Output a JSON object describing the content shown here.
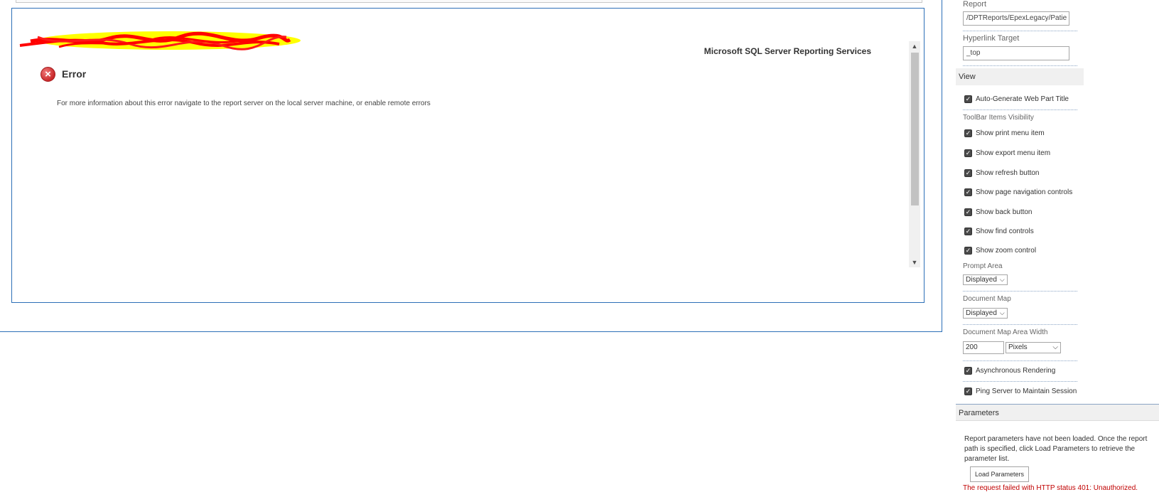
{
  "report_viewer": {
    "product_title": "Microsoft SQL Server Reporting Services",
    "error_title": "Error",
    "error_message": "For more information about this error navigate to the report server on the local server machine, or enable remote errors"
  },
  "tool_pane": {
    "report_label": "Report",
    "report_path": "/DPTReports/EpexLegacy/Patie",
    "hyperlink_target_label": "Hyperlink Target",
    "hyperlink_target_value": "_top",
    "view_header": "View",
    "auto_title_label": "Auto-Generate Web Part Title",
    "toolbar_visibility_label": "ToolBar Items Visibility",
    "toolbar_items": [
      "Show print menu item",
      "Show export menu item",
      "Show refresh button",
      "Show page navigation controls",
      "Show back button",
      "Show find controls",
      "Show zoom control"
    ],
    "prompt_area_label": "Prompt Area",
    "prompt_area_value": "Displayed",
    "document_map_label": "Document Map",
    "document_map_value": "Displayed",
    "doc_map_width_label": "Document Map Area Width",
    "doc_map_width_value": "200",
    "doc_map_width_unit": "Pixels",
    "async_label": "Asynchronous Rendering",
    "ping_label": "Ping Server to Maintain Session",
    "parameters_header": "Parameters",
    "parameters_text": "Report parameters have not been loaded. Once the report path is specified, click Load Parameters to retrieve the parameter list.",
    "load_parameters_button": "Load Parameters",
    "error_status": "The request failed with HTTP status 401: Unauthorized."
  },
  "colors": {
    "frame_border": "#2c6fb7",
    "error_red": "#c00000",
    "highlight_yellow": "#ffff00",
    "scribble_red": "#ff0000"
  }
}
